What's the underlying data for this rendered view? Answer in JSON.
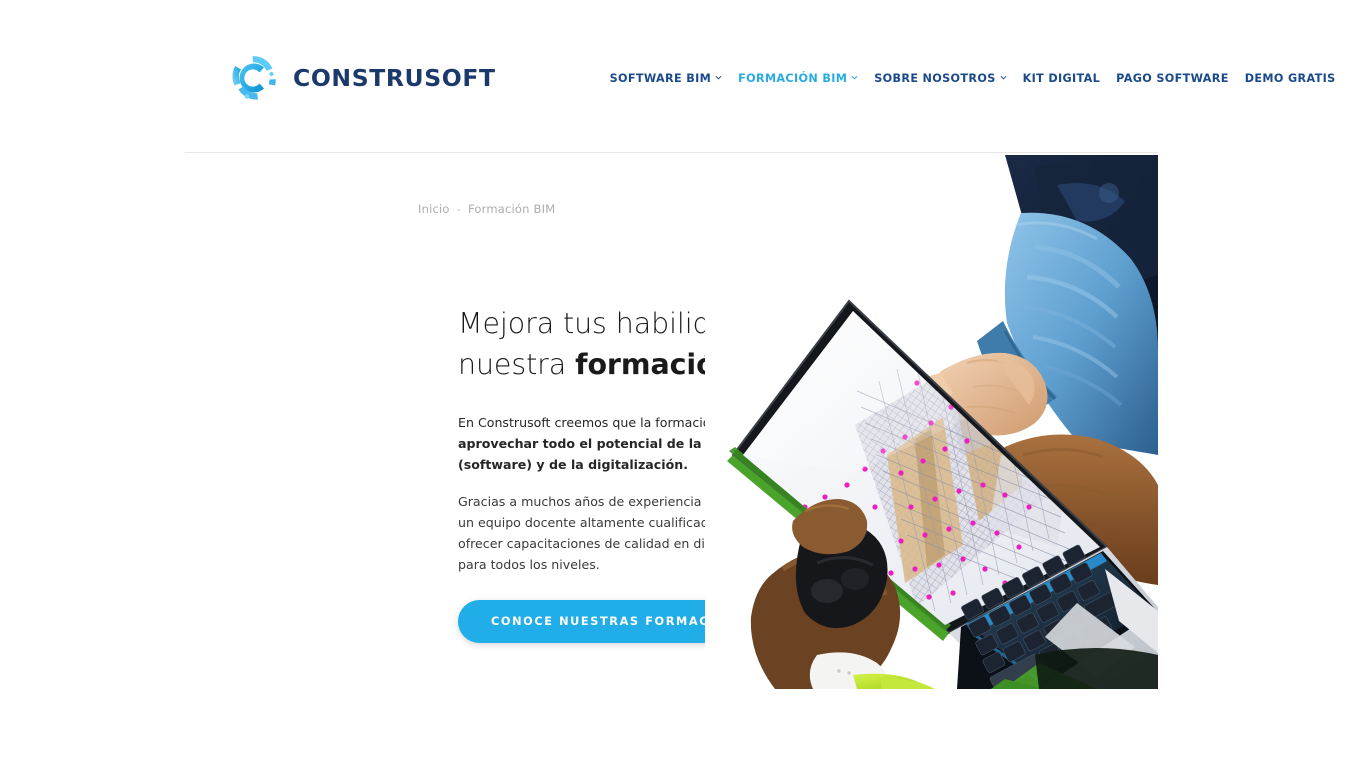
{
  "brand": {
    "name": "CONSTRUSOFT",
    "logo_icon": "construsoft-swirl-logo",
    "logo_color": "#29abe2",
    "text_color": "#1b3a6b"
  },
  "nav": {
    "items": [
      {
        "label": "SOFTWARE BIM",
        "has_dropdown": true,
        "active": false
      },
      {
        "label": "FORMACIÓN BIM",
        "has_dropdown": true,
        "active": true
      },
      {
        "label": "SOBRE NOSOTROS",
        "has_dropdown": true,
        "active": false
      },
      {
        "label": "KIT DIGITAL",
        "has_dropdown": false,
        "active": false
      },
      {
        "label": "PAGO SOFTWARE",
        "has_dropdown": false,
        "active": false
      },
      {
        "label": "DEMO GRATIS",
        "has_dropdown": false,
        "active": false
      }
    ],
    "icons": [
      {
        "name": "search-icon",
        "glyph": "search",
        "color": "#1b4a8a"
      },
      {
        "name": "cart-icon",
        "glyph": "cart",
        "color": "#e8522a"
      }
    ],
    "active_color": "#29abe2",
    "link_color": "#1b4a8a"
  },
  "breadcrumb": {
    "home": "Inicio",
    "separator": "-",
    "current": "Formación BIM"
  },
  "hero": {
    "title_light": "Mejora tus habilidades con nuestra",
    "title_bold": "formación",
    "lead_plain": "En Construsoft creemos que la formación es ",
    "lead_bold": "clave para aprovechar todo el potencial de la tecnología (software) y de la digitalización.",
    "body": "Gracias a muchos años de experiencia en BIM, disponemos de un equipo docente altamente cualificado que nos permite ofrecer capacitaciones de calidad en diferentes formatos y para todos los niveles.",
    "cta_label": "CONOCE NUESTRAS FORMACIONES",
    "cta_color": "#20ade8",
    "image_alt": "laptop-bim-model-hands-photo"
  }
}
